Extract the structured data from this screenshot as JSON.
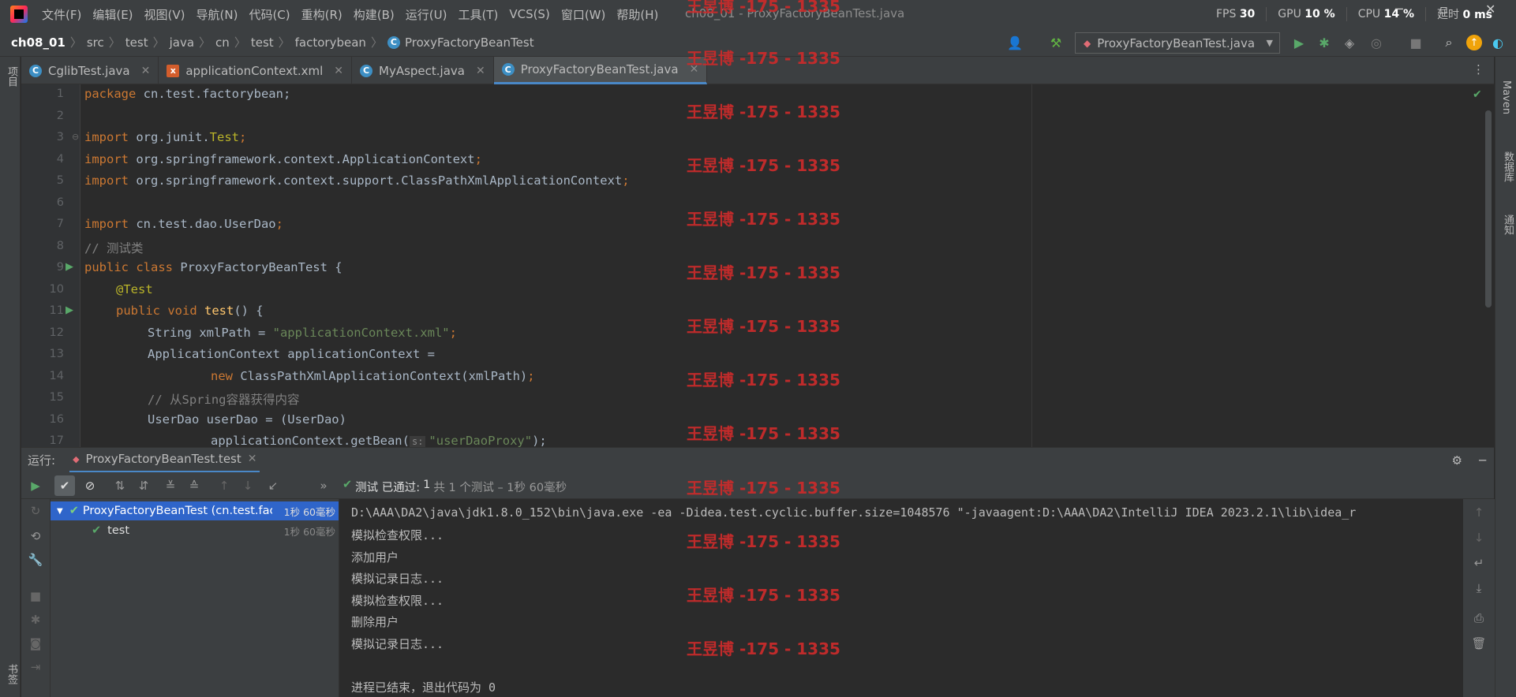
{
  "menu": {
    "items": [
      "文件(F)",
      "编辑(E)",
      "视图(V)",
      "导航(N)",
      "代码(C)",
      "重构(R)",
      "构建(B)",
      "运行(U)",
      "工具(T)",
      "VCS(S)",
      "窗口(W)",
      "帮助(H)"
    ],
    "window_title": "ch08_01 - ProxyFactoryBeanTest.java"
  },
  "stats": {
    "fps_label": "FPS",
    "fps": "30",
    "gpu_label": "GPU",
    "gpu": "10 %",
    "cpu_label": "CPU",
    "cpu": "14 %",
    "latency_label": "延时",
    "latency": "0 ms"
  },
  "breadcrumbs": [
    "ch08_01",
    "src",
    "test",
    "java",
    "cn",
    "test",
    "factorybean",
    "ProxyFactoryBeanTest"
  ],
  "run_config": "ProxyFactoryBeanTest.java",
  "side": {
    "left_project": "项目",
    "left_bookmarks": "书签",
    "right_maven": "Maven",
    "right_database": "数据库",
    "right_notifications": "通知"
  },
  "tabs": [
    {
      "label": "CglibTest.java",
      "icon": "class-icon"
    },
    {
      "label": "applicationContext.xml",
      "icon": "xml-icon"
    },
    {
      "label": "MyAspect.java",
      "icon": "class-icon"
    },
    {
      "label": "ProxyFactoryBeanTest.java",
      "icon": "class-icon",
      "active": true
    }
  ],
  "code": {
    "line_numbers": [
      "1",
      "2",
      "3",
      "4",
      "5",
      "6",
      "7",
      "8",
      "9",
      "10",
      "11",
      "12",
      "13",
      "14",
      "15",
      "16",
      "17"
    ],
    "l1a": "package ",
    "l1b": "cn.test.factorybean;",
    "l3a": "import ",
    "l3b": "org.junit.",
    "l3c": "Test",
    "l3d": ";",
    "l4a": "import ",
    "l4b": "org.springframework.context.ApplicationContext",
    "l4c": ";",
    "l5a": "import ",
    "l5b": "org.springframework.context.support.ClassPathXmlApplicationContext",
    "l5c": ";",
    "l7a": "import ",
    "l7b": "cn.test.dao.UserDao",
    "l7c": ";",
    "l8": "// 测试类",
    "l9a": "public class ",
    "l9b": "ProxyFactoryBeanTest {",
    "l10": "@Test",
    "l11a": "public void ",
    "l11b": "test",
    "l11c": "() {",
    "l12a": "String xmlPath = ",
    "l12b": "\"applicationContext.xml\"",
    "l12c": ";",
    "l13": "ApplicationContext applicationContext =",
    "l14a": "new ",
    "l14b": "ClassPathXmlApplicationContext(xmlPath)",
    "l14c": ";",
    "l15": "// 从Spring容器获得内容",
    "l16": "UserDao userDao = (UserDao)",
    "l17a": "applicationContext.getBean(",
    "l17hint": "s:",
    "l17b": "\"userDaoProxy\"",
    "l17c": ");"
  },
  "run": {
    "label": "运行:",
    "tab": "ProxyFactoryBeanTest.test",
    "status_prefix": "测试 已通过:",
    "status_count": "1",
    "status_rest": "共 1 个测试 – 1秒 60毫秒",
    "tree": [
      {
        "label": "ProxyFactoryBeanTest (cn.test.fac",
        "time": "1秒 60毫秒"
      },
      {
        "label": "test",
        "time": "1秒 60毫秒"
      }
    ],
    "console": [
      "D:\\AAA\\DA2\\java\\jdk1.8.0_152\\bin\\java.exe -ea -Didea.test.cyclic.buffer.size=1048576 \"-javaagent:D:\\AAA\\DA2\\IntelliJ IDEA 2023.2.1\\lib\\idea_r",
      "模拟检查权限...",
      "添加用户",
      "模拟记录日志...",
      "模拟检查权限...",
      "删除用户",
      "模拟记录日志...",
      "",
      "进程已结束，退出代码为 0"
    ]
  },
  "watermark": "王昱博 -175 - 1335"
}
